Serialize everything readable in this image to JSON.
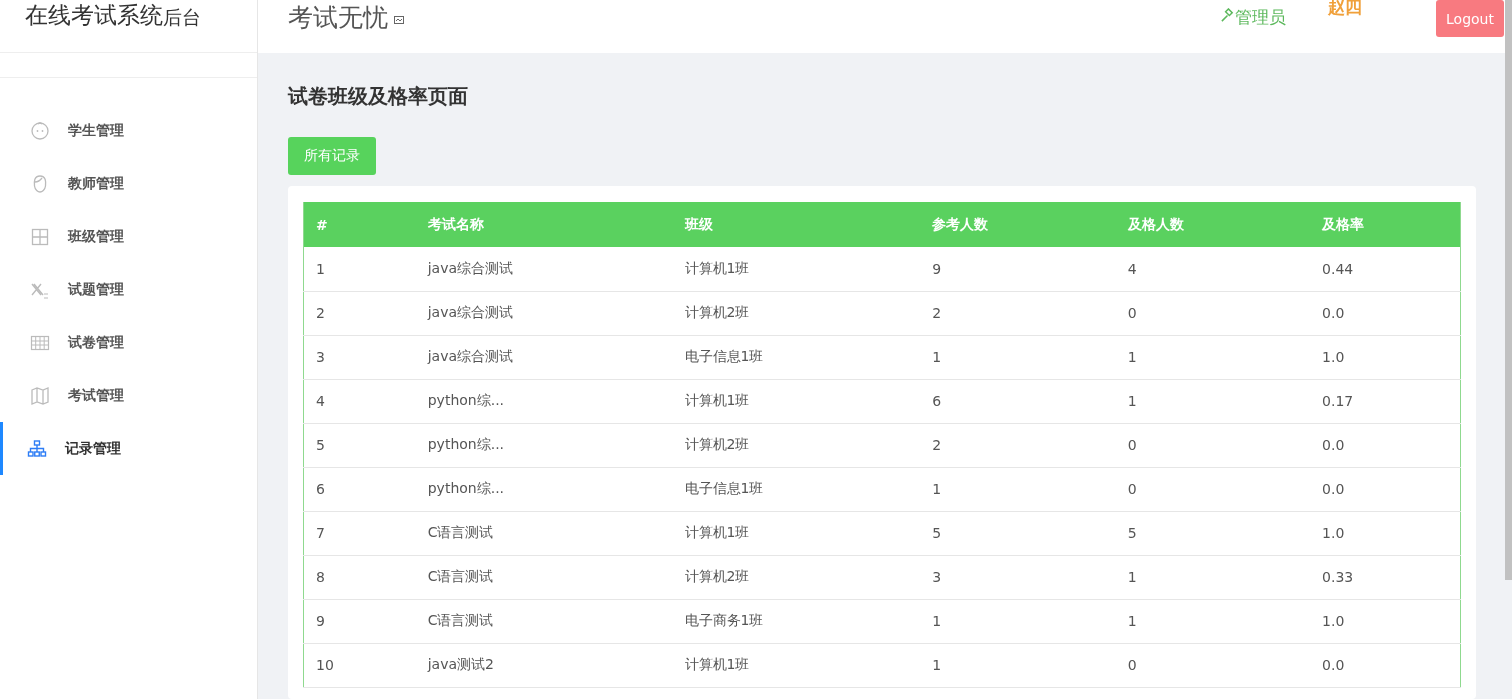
{
  "app_title": {
    "main": "在线考试系统",
    "suffix": "后台"
  },
  "header": {
    "brand": "考试无忧",
    "role": "管理员",
    "user": "赵四",
    "logout": "Logout"
  },
  "sidebar": {
    "items": [
      {
        "label": "学生管理",
        "selected": false
      },
      {
        "label": "教师管理",
        "selected": false
      },
      {
        "label": "班级管理",
        "selected": false
      },
      {
        "label": "试题管理",
        "selected": false
      },
      {
        "label": "试卷管理",
        "selected": false
      },
      {
        "label": "考试管理",
        "selected": false
      },
      {
        "label": "记录管理",
        "selected": true
      }
    ]
  },
  "page": {
    "title": "试卷班级及格率页面",
    "button": "所有记录"
  },
  "table": {
    "columns": [
      "#",
      "考试名称",
      "班级",
      "参考人数",
      "及格人数",
      "及格率"
    ],
    "rows": [
      [
        "1",
        "java综合测试",
        "计算机1班",
        "9",
        "4",
        "0.44"
      ],
      [
        "2",
        "java综合测试",
        "计算机2班",
        "2",
        "0",
        "0.0"
      ],
      [
        "3",
        "java综合测试",
        "电子信息1班",
        "1",
        "1",
        "1.0"
      ],
      [
        "4",
        "python综...",
        "计算机1班",
        "6",
        "1",
        "0.17"
      ],
      [
        "5",
        "python综...",
        "计算机2班",
        "2",
        "0",
        "0.0"
      ],
      [
        "6",
        "python综...",
        "电子信息1班",
        "1",
        "0",
        "0.0"
      ],
      [
        "7",
        "C语言测试",
        "计算机1班",
        "5",
        "5",
        "1.0"
      ],
      [
        "8",
        "C语言测试",
        "计算机2班",
        "3",
        "1",
        "0.33"
      ],
      [
        "9",
        "C语言测试",
        "电子商务1班",
        "1",
        "1",
        "1.0"
      ],
      [
        "10",
        "java测试2",
        "计算机1班",
        "1",
        "0",
        "0.0"
      ]
    ]
  }
}
